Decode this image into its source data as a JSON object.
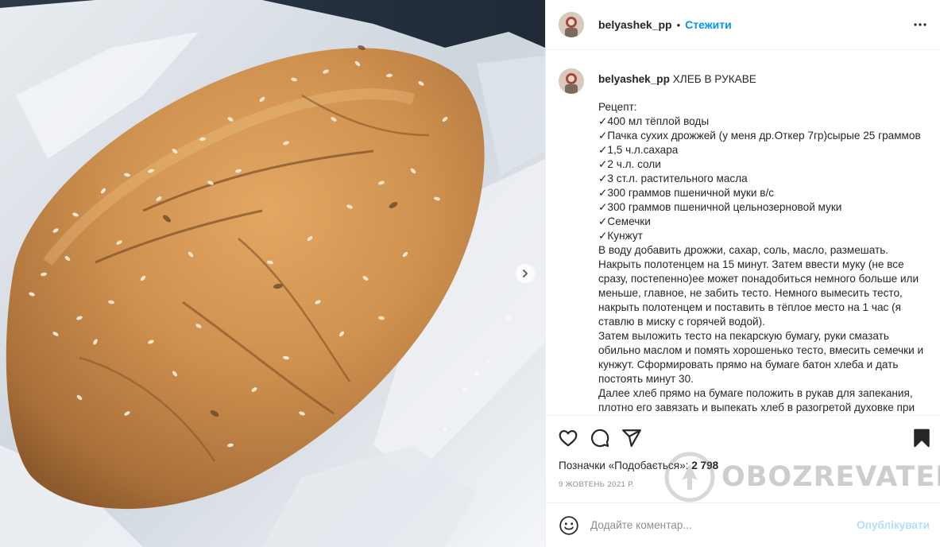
{
  "post": {
    "username": "belyashek_pp",
    "separator": "•",
    "follow_label": "Стежити",
    "more_icon": "more-horizontal-icon"
  },
  "caption": {
    "username": "belyashek_pp",
    "title": "ХЛЕБ В РУКАВЕ",
    "lines": [
      "Рецепт:",
      "✓400 мл тёплой воды",
      "✓Пачка сухих дрожжей (у меня др.Откер 7гр)сырые 25 граммов",
      "✓1,5 ч.л.сахара",
      "✓2 ч.л. соли",
      "✓3 ст.л. растительного масла",
      "✓300 граммов пшеничной муки в/с",
      "✓300 граммов пшеничной цельнозерновой муки",
      "✓Семечки",
      "✓Кунжут",
      "В воду добавить дрожжи, сахар, соль, масло, размешать.",
      "Накрыть полотенцем на 15 минут. Затем ввести муку (не все",
      "сразу, постепенно)ее может понадобиться немного больше или",
      "меньше, главное, не забить тесто. Немного вымесить тесто,",
      "накрыть полотенцем и поставить в тёплое место на 1 час (я",
      "ставлю в миску с горячей водой).",
      "Затем выложить тесто на пекарскую бумагу, руки смазать",
      "обильно маслом и помять хорошенько тесто, вмесить семечки и",
      "кунжут. Сформировать прямо на бумаге батон хлеба и дать",
      "постоять минут 30.",
      "Далее хлеб прямо на бумаге положить в рукав для запекания,",
      "плотно его завязать и выпекать хлеб в разогретой духовке при"
    ]
  },
  "actions": {
    "like_icon": "heart-icon",
    "comment_icon": "comment-icon",
    "share_icon": "share-icon",
    "save_icon": "bookmark-icon"
  },
  "likes": {
    "label": "Позначки «Подобається»:",
    "count": "2 798"
  },
  "date": "9 ЖОВТЕНЬ 2021 Р.",
  "comment": {
    "placeholder": "Додайте коментар...",
    "publish_label": "Опублікувати",
    "emoji_icon": "smiley-icon"
  },
  "watermark": {
    "text": "OBOZREVATEL"
  },
  "colors": {
    "link": "#0095f6",
    "publish_disabled": "#b2dffc",
    "crust": "#c98f4e"
  }
}
